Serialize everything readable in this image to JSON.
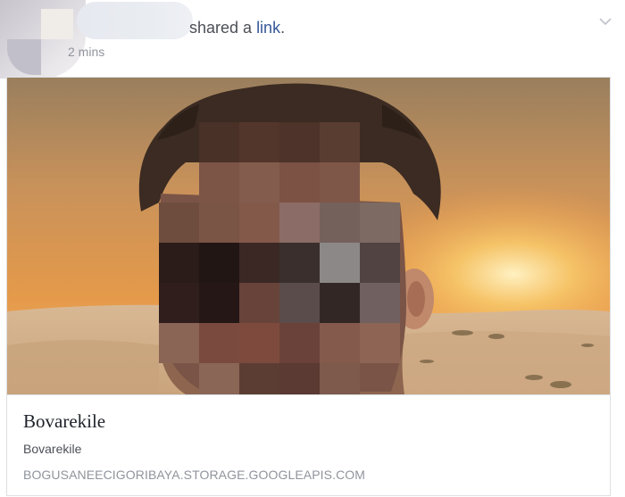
{
  "post": {
    "action_text": "shared a ",
    "action_link": "link",
    "action_end": ".",
    "timestamp": "2 mins",
    "menu_icon": "chevron-down-icon"
  },
  "link_preview": {
    "image_subject": "selfie-in-desert-sunset",
    "title": "Bovarekile",
    "description": "Bovarekile",
    "domain": "BOGUSANEECIGORIBAYA.STORAGE.GOOGLEAPIS.COM"
  },
  "colors": {
    "link_blue": "#365899",
    "meta_grey": "#90949c",
    "text_dark": "#1d2129",
    "border": "#dddfe2"
  }
}
